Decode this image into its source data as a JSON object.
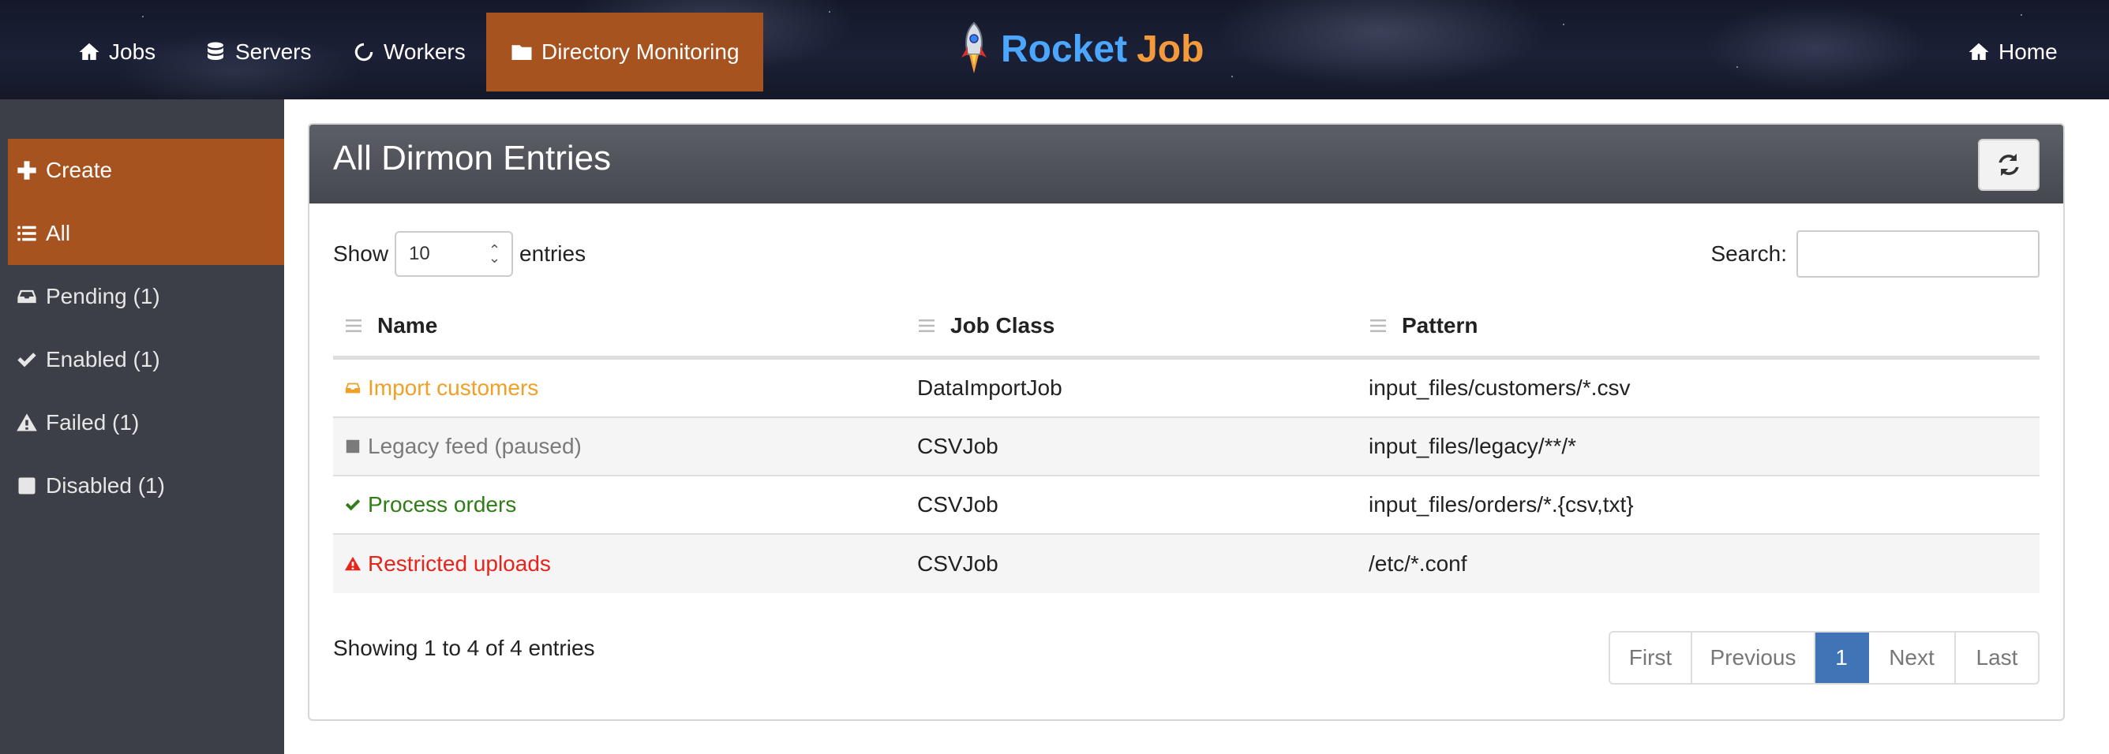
{
  "nav": {
    "links": [
      {
        "label": "Jobs",
        "icon": "home-icon"
      },
      {
        "label": "Servers",
        "icon": "database-icon"
      },
      {
        "label": "Workers",
        "icon": "spinner-icon"
      },
      {
        "label": "Directory Monitoring",
        "icon": "folder-icon",
        "active": true
      }
    ],
    "brand_part1": "Rocket",
    "brand_part2": "Job",
    "home_label": "Home"
  },
  "sidebar": {
    "items": [
      {
        "label": "Create",
        "icon": "plus-icon",
        "active": true
      },
      {
        "label": "All",
        "icon": "list-icon",
        "active": true
      },
      {
        "label": "Pending (1)",
        "icon": "inbox-icon"
      },
      {
        "label": "Enabled (1)",
        "icon": "check-icon"
      },
      {
        "label": "Failed (1)",
        "icon": "warning-icon"
      },
      {
        "label": "Disabled (1)",
        "icon": "stop-icon"
      }
    ]
  },
  "panel": {
    "title": "All Dirmon Entries",
    "show_label": "Show",
    "page_size": "10",
    "entries_label": "entries",
    "search_label": "Search:",
    "search_value": ""
  },
  "table": {
    "headers": [
      "Name",
      "Job Class",
      "Pattern"
    ],
    "rows": [
      {
        "name": "Import customers",
        "job_class": "DataImportJob",
        "pattern": "input_files/customers/*.csv",
        "status": "pending",
        "color": "#f0a024"
      },
      {
        "name": "Legacy feed (paused)",
        "job_class": "CSVJob",
        "pattern": "input_files/legacy/**/*",
        "status": "disabled",
        "color": "#7a7a7a"
      },
      {
        "name": "Process orders",
        "job_class": "CSVJob",
        "pattern": "input_files/orders/*.{csv,txt}",
        "status": "enabled",
        "color": "#2e7d16"
      },
      {
        "name": "Restricted uploads",
        "job_class": "CSVJob",
        "pattern": "/etc/*.conf",
        "status": "failed",
        "color": "#e5241c"
      }
    ]
  },
  "footer": {
    "info": "Showing 1 to 4 of 4 entries",
    "pagination": [
      "First",
      "Previous",
      "1",
      "Next",
      "Last"
    ],
    "current_page": "1"
  },
  "colors": {
    "accent": "#a65320",
    "pagination_active": "#3f74b6"
  }
}
